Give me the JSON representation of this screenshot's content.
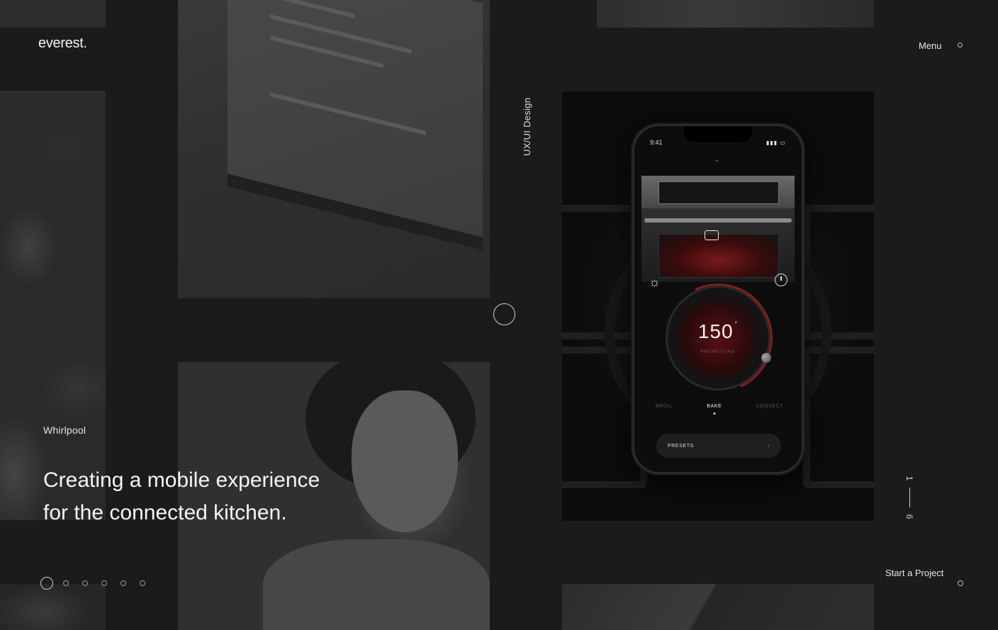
{
  "header": {
    "logo": "everest.",
    "menu_label": "Menu"
  },
  "project": {
    "category": "UX/UI Design",
    "client": "Whirlpool",
    "headline_line1": "Creating a mobile experience",
    "headline_line2": "for the connected kitchen."
  },
  "slider": {
    "current": "1",
    "total": "6",
    "dots": [
      "slide-1",
      "slide-2",
      "slide-3",
      "slide-4",
      "slide-5",
      "slide-6"
    ],
    "active_index": 0
  },
  "cta": {
    "start_project": "Start a Project"
  },
  "phone_mock": {
    "time": "9:41",
    "temperature": "150",
    "degree": "°",
    "status": "PREHEATING",
    "modes": [
      "BROIL",
      "BAKE",
      "CONVECT"
    ],
    "active_mode": "BAKE",
    "presets_label": "PRESETS"
  },
  "colors": {
    "background": "#1b1b1b",
    "text": "#f4f4f4",
    "accent_red": "#8a1a1a"
  }
}
